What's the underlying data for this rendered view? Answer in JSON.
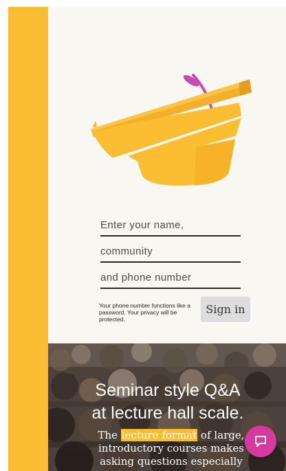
{
  "login": {
    "name_placeholder": "Enter your name,",
    "community_placeholder": "community",
    "phone_placeholder": "and phone number",
    "privacy_note": "Your phone number functions like a password. Your privacy will be protected.",
    "sign_in_label": "Sign in"
  },
  "feature": {
    "heading_line_1": "Seminar style Q&A",
    "heading_line_2": "at lecture hall scale.",
    "description_prefix": "The ",
    "highlight_text": "lecture format",
    "description_suffix": " of large,",
    "description_line_2": "introductory courses makes",
    "description_line_3": "asking questions especially"
  },
  "icons": {
    "podium": "podium-icon",
    "chat": "chat-bubble-icon"
  },
  "colors": {
    "brand_yellow": "#fbbd31",
    "hero_background": "#f8f7f2",
    "chat_magenta": "#d63a9e",
    "microphone_magenta": "#c94ab0"
  }
}
